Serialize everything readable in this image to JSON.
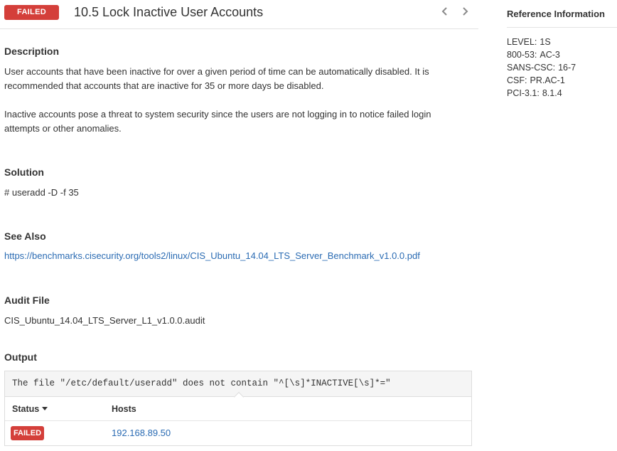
{
  "header": {
    "status_badge": "FAILED",
    "title": "10.5 Lock Inactive User Accounts",
    "prev_icon": "chevron-left-icon",
    "next_icon": "chevron-right-icon"
  },
  "description": {
    "heading": "Description",
    "paragraph_1_line_1": "User accounts that have been inactive for over a given period of time can be automatically disabled. It is",
    "paragraph_1_line_2": "recommended that accounts that are inactive for 35 or more days be disabled.",
    "paragraph_2_line_1": "Inactive accounts pose a threat to system security since the users are not logging in to notice failed login",
    "paragraph_2_line_2": "attempts or other anomalies."
  },
  "solution": {
    "heading": "Solution",
    "text": "# useradd -D -f 35"
  },
  "see_also": {
    "heading": "See Also",
    "link": "https://benchmarks.cisecurity.org/tools2/linux/CIS_Ubuntu_14.04_LTS_Server_Benchmark_v1.0.0.pdf"
  },
  "audit_file": {
    "heading": "Audit File",
    "text": "CIS_Ubuntu_14.04_LTS_Server_L1_v1.0.0.audit"
  },
  "output": {
    "heading": "Output",
    "message": "The file \"/etc/default/useradd\" does not contain \"^[\\s]*INACTIVE[\\s]*=\"",
    "columns": {
      "status": "Status",
      "hosts": "Hosts"
    },
    "rows": [
      {
        "status": "FAILED",
        "host": "192.168.89.50"
      }
    ]
  },
  "reference": {
    "title": "Reference Information",
    "items": [
      {
        "key": "LEVEL:",
        "value": "1S"
      },
      {
        "key": "800-53:",
        "value": "AC-3"
      },
      {
        "key": "SANS-CSC:",
        "value": "16-7"
      },
      {
        "key": "CSF:",
        "value": "PR.AC-1"
      },
      {
        "key": "PCI-3.1:",
        "value": "8.1.4"
      }
    ]
  },
  "colors": {
    "failed": "#d43f3a",
    "link": "#2a6bb3"
  }
}
